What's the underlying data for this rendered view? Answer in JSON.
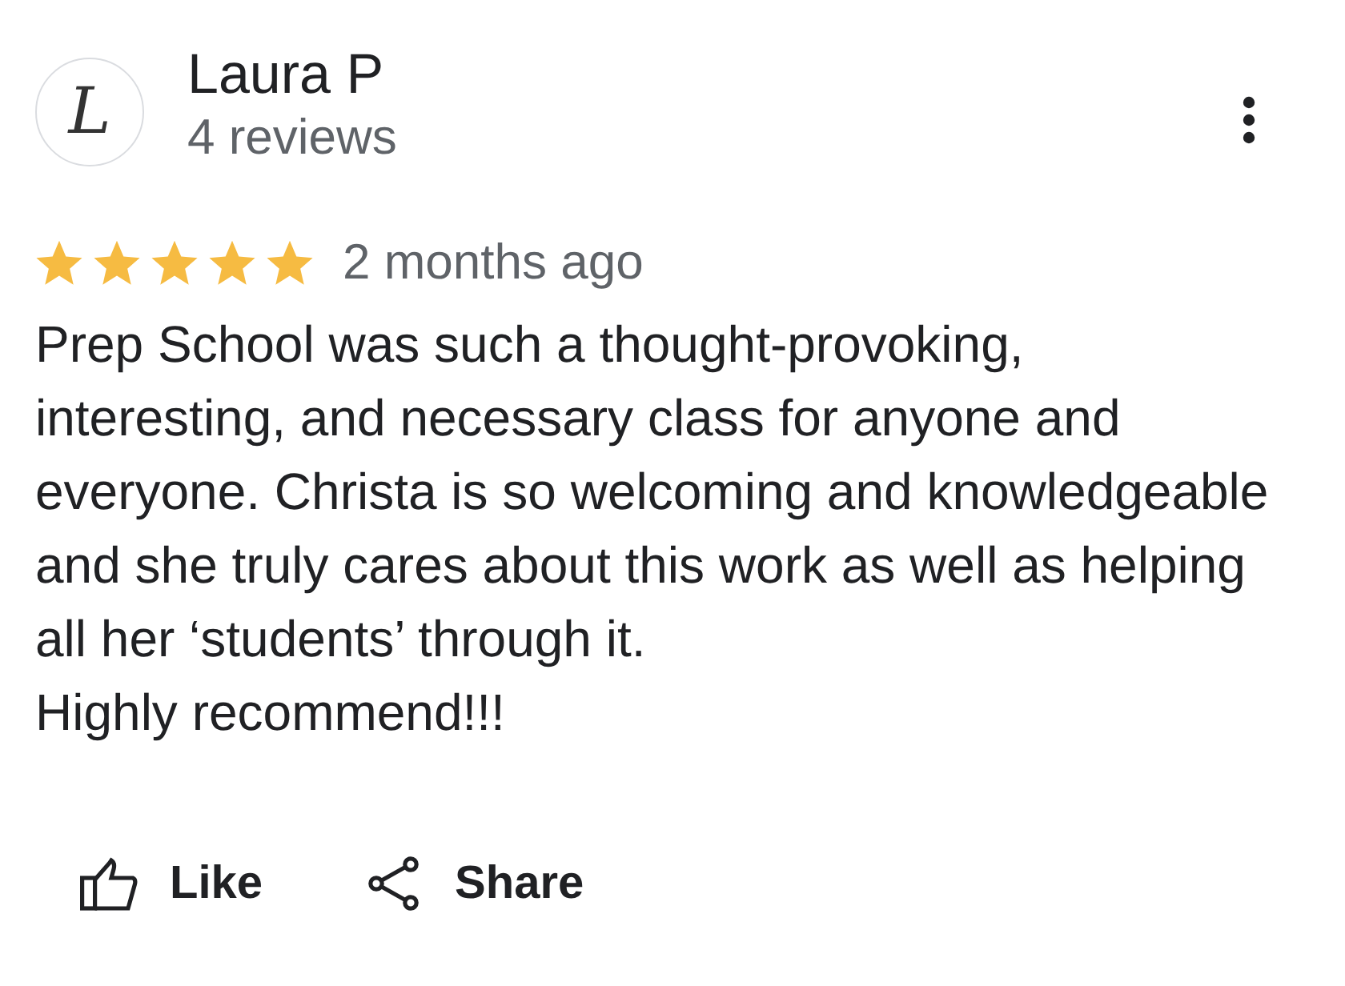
{
  "reviewer": {
    "avatar_letter": "L",
    "name": "Laura P",
    "review_count": "4 reviews"
  },
  "review": {
    "stars": 5,
    "time": "2 months ago",
    "text": "Prep School was such a thought-provoking, interesting, and necessary class for anyone and everyone. Christa is so welcoming and knowledgeable and she truly cares about this work as well as helping all her ‘students’ through it.\nHighly recommend!!!"
  },
  "actions": [
    {
      "kind": "like",
      "label": "Like"
    },
    {
      "kind": "share",
      "label": "Share"
    }
  ]
}
